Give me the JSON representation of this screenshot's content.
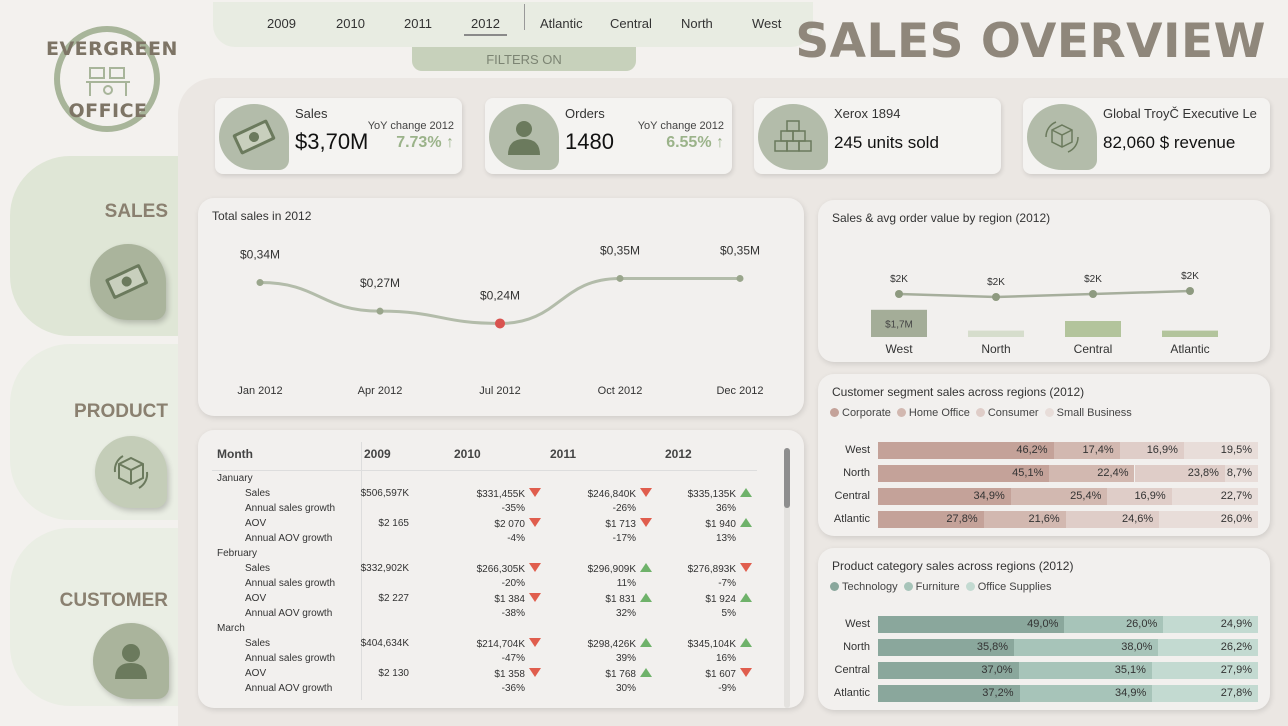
{
  "logo": {
    "line1": "EVERGREEN",
    "line2": "OFFICE"
  },
  "nav": {
    "sales": "SALES",
    "product": "PRODUCT",
    "customer": "CUSTOMER"
  },
  "filters": {
    "years": [
      "2009",
      "2010",
      "2011",
      "2012"
    ],
    "selected_year": "2012",
    "regions": [
      "Atlantic",
      "Central",
      "North",
      "West"
    ],
    "status": "FILTERS ON"
  },
  "title": "SALES OVERVIEW",
  "kpis": {
    "sales": {
      "label": "Sales",
      "value": "$3,70M",
      "yoy_label": "YoY change 2012",
      "yoy_value": "7.73% ↑"
    },
    "orders": {
      "label": "Orders",
      "value": "1480",
      "yoy_label": "YoY change 2012",
      "yoy_value": "6.55% ↑"
    },
    "product": {
      "label": "Xerox 1894",
      "value": "245 units sold"
    },
    "top_product": {
      "label": "Global TroyČ Executive Le",
      "value": "82,060 $ revenue"
    }
  },
  "colors": {
    "accent_green": "#9bb38a",
    "down_red": "#e05d4d",
    "up_green": "#6fb26a",
    "corporate": "#c4a299",
    "home_office": "#d2b8b0",
    "consumer": "#dfcdc8",
    "small_business": "#e8ddd9",
    "technology": "#8aa79c",
    "furniture": "#a7c4b9",
    "office_supplies": "#c3dad1"
  },
  "line_chart": {
    "title": "Total sales in 2012",
    "chart_data": {
      "type": "line",
      "x": [
        "Jan 2012",
        "Apr 2012",
        "Jul 2012",
        "Oct 2012",
        "Dec 2012"
      ],
      "values": [
        0.34,
        0.27,
        0.24,
        0.35,
        0.35
      ],
      "labels": [
        "$0,34M",
        "$0,27M",
        "$0,24M",
        "$0,35M",
        "$0,35M"
      ],
      "highlight_index": 2
    }
  },
  "region_chart": {
    "title": "Sales & avg order value by region (2012)",
    "chart_data": {
      "type": "bar",
      "categories": [
        "West",
        "North",
        "Central",
        "Atlantic"
      ],
      "bar_values": [
        1.7,
        0.4,
        1.0,
        0.4
      ],
      "bar_labels": [
        "$1,7M",
        "",
        "",
        ""
      ],
      "line_labels": [
        "$2K",
        "$2K",
        "$2K",
        "$2K"
      ],
      "line_values": [
        2.1,
        2.05,
        2.1,
        2.15
      ]
    }
  },
  "segment_chart": {
    "title": "Customer segment sales across regions (2012)",
    "legend": [
      "Corporate",
      "Home Office",
      "Consumer",
      "Small Business"
    ],
    "chart_data": {
      "type": "bar",
      "stacked": "100%",
      "categories": [
        "West",
        "North",
        "Central",
        "Atlantic"
      ],
      "series": [
        {
          "name": "Corporate",
          "values": [
            46.2,
            45.1,
            34.9,
            27.8
          ],
          "labels": [
            "46,2%",
            "45,1%",
            "34,9%",
            "27,8%"
          ]
        },
        {
          "name": "Home Office",
          "values": [
            17.4,
            22.4,
            25.4,
            21.6
          ],
          "labels": [
            "17,4%",
            "22,4%",
            "25,4%",
            "21,6%"
          ]
        },
        {
          "name": "Consumer",
          "values": [
            16.9,
            23.8,
            16.9,
            24.6
          ],
          "labels": [
            "16,9%",
            "23,8%",
            "16,9%",
            "24,6%"
          ]
        },
        {
          "name": "Small Business",
          "values": [
            19.5,
            8.7,
            22.7,
            26.0
          ],
          "labels": [
            "19,5%",
            "8,7%",
            "22,7%",
            "26,0%"
          ]
        }
      ]
    }
  },
  "category_chart": {
    "title": "Product category sales across regions (2012)",
    "legend": [
      "Technology",
      "Furniture",
      "Office Supplies"
    ],
    "chart_data": {
      "type": "bar",
      "stacked": "100%",
      "categories": [
        "West",
        "North",
        "Central",
        "Atlantic"
      ],
      "series": [
        {
          "name": "Technology",
          "values": [
            49.0,
            35.8,
            37.0,
            37.2
          ],
          "labels": [
            "49,0%",
            "35,8%",
            "37,0%",
            "37,2%"
          ]
        },
        {
          "name": "Furniture",
          "values": [
            26.0,
            38.0,
            35.1,
            34.9
          ],
          "labels": [
            "26,0%",
            "38,0%",
            "35,1%",
            "34,9%"
          ]
        },
        {
          "name": "Office Supplies",
          "values": [
            24.9,
            26.2,
            27.9,
            27.8
          ],
          "labels": [
            "24,9%",
            "26,2%",
            "27,9%",
            "27,8%"
          ]
        }
      ]
    }
  },
  "matrix": {
    "headers": [
      "Month",
      "2009",
      "2010",
      "2011",
      "2012"
    ],
    "groups": [
      {
        "month": "January",
        "rows": [
          {
            "label": "Sales",
            "values": [
              "$506,597K",
              "$331,455K",
              "$246,840K",
              "$335,135K"
            ],
            "trend": [
              "",
              "down",
              "down",
              "up"
            ]
          },
          {
            "label": "Annual sales growth",
            "values": [
              "",
              "-35%",
              "-26%",
              "36%"
            ],
            "trend": [
              "",
              "",
              "",
              ""
            ]
          },
          {
            "label": "AOV",
            "values": [
              "$2 165",
              "$2 070",
              "$1 713",
              "$1 940"
            ],
            "trend": [
              "",
              "down",
              "down",
              "up"
            ]
          },
          {
            "label": "Annual AOV growth",
            "values": [
              "",
              "-4%",
              "-17%",
              "13%"
            ],
            "trend": [
              "",
              "",
              "",
              ""
            ]
          }
        ]
      },
      {
        "month": "February",
        "rows": [
          {
            "label": "Sales",
            "values": [
              "$332,902K",
              "$266,305K",
              "$296,909K",
              "$276,893K"
            ],
            "trend": [
              "",
              "down",
              "up",
              "down"
            ]
          },
          {
            "label": "Annual sales growth",
            "values": [
              "",
              "-20%",
              "11%",
              "-7%"
            ],
            "trend": [
              "",
              "",
              "",
              ""
            ]
          },
          {
            "label": "AOV",
            "values": [
              "$2 227",
              "$1 384",
              "$1 831",
              "$1 924"
            ],
            "trend": [
              "",
              "down",
              "up",
              "up"
            ]
          },
          {
            "label": "Annual AOV growth",
            "values": [
              "",
              "-38%",
              "32%",
              "5%"
            ],
            "trend": [
              "",
              "",
              "",
              ""
            ]
          }
        ]
      },
      {
        "month": "March",
        "rows": [
          {
            "label": "Sales",
            "values": [
              "$404,634K",
              "$214,704K",
              "$298,426K",
              "$345,104K"
            ],
            "trend": [
              "",
              "down",
              "up",
              "up"
            ]
          },
          {
            "label": "Annual sales growth",
            "values": [
              "",
              "-47%",
              "39%",
              "16%"
            ],
            "trend": [
              "",
              "",
              "",
              ""
            ]
          },
          {
            "label": "AOV",
            "values": [
              "$2 130",
              "$1 358",
              "$1 768",
              "$1 607"
            ],
            "trend": [
              "",
              "down",
              "up",
              "down"
            ]
          },
          {
            "label": "Annual AOV growth",
            "values": [
              "",
              "-36%",
              "30%",
              "-9%"
            ],
            "trend": [
              "",
              "",
              "",
              ""
            ]
          }
        ]
      }
    ]
  }
}
